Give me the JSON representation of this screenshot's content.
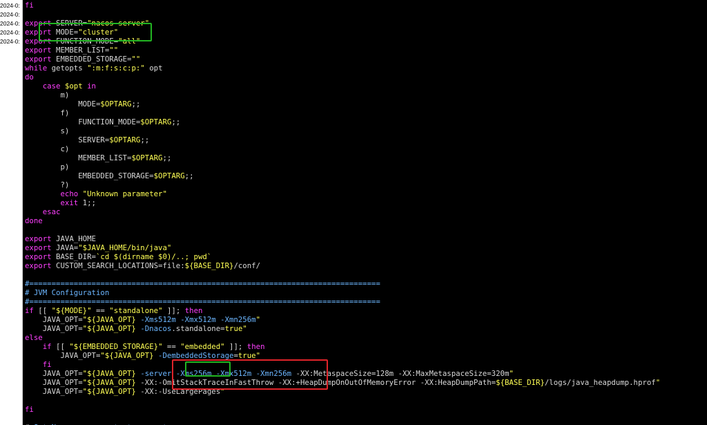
{
  "colors": {
    "background": "#000000",
    "default": "#d8d8d8",
    "keyword": "#ff40ff",
    "string": "#ffff55",
    "variable": "#ffff55",
    "comment": "#6cb6ff",
    "flag": "#6cb6ff",
    "highlight_green": "#22b522",
    "highlight_red": "#e0242a",
    "gutter_bg": "#ffffff"
  },
  "gutter": {
    "lines": [
      "2024-0:",
      "2024-0:",
      "2024-0:",
      "2024-0:",
      "2024-0:"
    ]
  },
  "code": {
    "lines": [
      [
        [
          "kw",
          "fi"
        ]
      ],
      [],
      [
        [
          "kw",
          "export"
        ],
        [
          "plain",
          " SERVER="
        ],
        [
          "str",
          "\"nacos-server\""
        ]
      ],
      [
        [
          "kw",
          "export"
        ],
        [
          "plain",
          " MODE="
        ],
        [
          "str",
          "\"cluster\""
        ]
      ],
      [
        [
          "kw",
          "export"
        ],
        [
          "plain",
          " FUNCTION_MODE="
        ],
        [
          "str",
          "\"all\""
        ]
      ],
      [
        [
          "kw",
          "export"
        ],
        [
          "plain",
          " MEMBER_LIST="
        ],
        [
          "str",
          "\"\""
        ]
      ],
      [
        [
          "kw",
          "export"
        ],
        [
          "plain",
          " EMBEDDED_STORAGE="
        ],
        [
          "str",
          "\"\""
        ]
      ],
      [
        [
          "kw",
          "while"
        ],
        [
          "plain",
          " getopts "
        ],
        [
          "str",
          "\":m:f:s:c:p:\""
        ],
        [
          "plain",
          " opt"
        ]
      ],
      [
        [
          "kw",
          "do"
        ]
      ],
      [
        [
          "plain",
          "    "
        ],
        [
          "kw",
          "case"
        ],
        [
          "plain",
          " "
        ],
        [
          "var",
          "$opt"
        ],
        [
          "plain",
          " "
        ],
        [
          "kw",
          "in"
        ]
      ],
      [
        [
          "plain",
          "        m)"
        ]
      ],
      [
        [
          "plain",
          "            MODE="
        ],
        [
          "var",
          "$OPTARG"
        ],
        [
          "plain",
          ";;"
        ]
      ],
      [
        [
          "plain",
          "        f)"
        ]
      ],
      [
        [
          "plain",
          "            FUNCTION_MODE="
        ],
        [
          "var",
          "$OPTARG"
        ],
        [
          "plain",
          ";;"
        ]
      ],
      [
        [
          "plain",
          "        s)"
        ]
      ],
      [
        [
          "plain",
          "            SERVER="
        ],
        [
          "var",
          "$OPTARG"
        ],
        [
          "plain",
          ";;"
        ]
      ],
      [
        [
          "plain",
          "        c)"
        ]
      ],
      [
        [
          "plain",
          "            MEMBER_LIST="
        ],
        [
          "var",
          "$OPTARG"
        ],
        [
          "plain",
          ";;"
        ]
      ],
      [
        [
          "plain",
          "        p)"
        ]
      ],
      [
        [
          "plain",
          "            EMBEDDED_STORAGE="
        ],
        [
          "var",
          "$OPTARG"
        ],
        [
          "plain",
          ";;"
        ]
      ],
      [
        [
          "plain",
          "        ?)"
        ]
      ],
      [
        [
          "plain",
          "        "
        ],
        [
          "kw",
          "echo"
        ],
        [
          "plain",
          " "
        ],
        [
          "str",
          "\"Unknown parameter\""
        ]
      ],
      [
        [
          "plain",
          "        "
        ],
        [
          "kw",
          "exit"
        ],
        [
          "plain",
          " 1;;"
        ]
      ],
      [
        [
          "plain",
          "    "
        ],
        [
          "kw",
          "esac"
        ]
      ],
      [
        [
          "kw",
          "done"
        ]
      ],
      [],
      [
        [
          "kw",
          "export"
        ],
        [
          "plain",
          " JAVA_HOME"
        ]
      ],
      [
        [
          "kw",
          "export"
        ],
        [
          "plain",
          " JAVA="
        ],
        [
          "str",
          "\"$JAVA_HOME/bin/java\""
        ]
      ],
      [
        [
          "kw",
          "export"
        ],
        [
          "plain",
          " BASE_DIR="
        ],
        [
          "str",
          "`cd $(dirname $0)/..; pwd`"
        ]
      ],
      [
        [
          "kw",
          "export"
        ],
        [
          "plain",
          " CUSTOM_SEARCH_LOCATIONS=file:"
        ],
        [
          "var",
          "${BASE_DIR}"
        ],
        [
          "plain",
          "/conf/"
        ]
      ],
      [],
      [
        [
          "cmt",
          "#==============================================================================="
        ]
      ],
      [
        [
          "cmt",
          "# JVM Configuration"
        ]
      ],
      [
        [
          "cmt",
          "#==============================================================================="
        ]
      ],
      [
        [
          "kw",
          "if"
        ],
        [
          "plain",
          " [[ "
        ],
        [
          "str",
          "\"${MODE}\""
        ],
        [
          "plain",
          " == "
        ],
        [
          "str",
          "\"standalone\""
        ],
        [
          "plain",
          " ]]; "
        ],
        [
          "kw",
          "then"
        ]
      ],
      [
        [
          "plain",
          "    JAVA_OPT="
        ],
        [
          "str",
          "\"${JAVA_OPT}"
        ],
        [
          "plain",
          " "
        ],
        [
          "flag",
          "-Xms512m -Xmx512m -Xmn256m"
        ],
        [
          "str",
          "\""
        ]
      ],
      [
        [
          "plain",
          "    JAVA_OPT="
        ],
        [
          "str",
          "\"${JAVA_OPT}"
        ],
        [
          "plain",
          " "
        ],
        [
          "flag",
          "-Dnacos"
        ],
        [
          "plain",
          ".standalone="
        ],
        [
          "str",
          "true\""
        ]
      ],
      [
        [
          "kw",
          "else"
        ]
      ],
      [
        [
          "plain",
          "    "
        ],
        [
          "kw",
          "if"
        ],
        [
          "plain",
          " [[ "
        ],
        [
          "str",
          "\"${EMBEDDED_STORAGE}\""
        ],
        [
          "plain",
          " == "
        ],
        [
          "str",
          "\"embedded\""
        ],
        [
          "plain",
          " ]]; "
        ],
        [
          "kw",
          "then"
        ]
      ],
      [
        [
          "plain",
          "        JAVA_OPT="
        ],
        [
          "str",
          "\"${JAVA_OPT}"
        ],
        [
          "plain",
          " "
        ],
        [
          "flag",
          "-DembeddedStorage"
        ],
        [
          "plain",
          "="
        ],
        [
          "str",
          "true\""
        ]
      ],
      [
        [
          "plain",
          "    "
        ],
        [
          "kw",
          "fi"
        ]
      ],
      [
        [
          "plain",
          "    JAVA_OPT="
        ],
        [
          "str",
          "\"${JAVA_OPT}"
        ],
        [
          "plain",
          " "
        ],
        [
          "flag",
          "-server -Xms256m -Xmx512m -Xmn256m"
        ],
        [
          "plain",
          " -XX:MetaspaceSize=128m -XX:MaxMetaspaceSize=320m"
        ],
        [
          "str",
          "\""
        ]
      ],
      [
        [
          "plain",
          "    JAVA_OPT="
        ],
        [
          "str",
          "\"${JAVA_OPT}"
        ],
        [
          "plain",
          " -XX:-OmitStackTraceInFastThrow -XX:+HeapDumpOnOutOfMemoryError -XX:HeapDumpPath="
        ],
        [
          "var",
          "${BASE_DIR}"
        ],
        [
          "plain",
          "/logs/java_heapdump.hprof"
        ],
        [
          "str",
          "\""
        ]
      ],
      [
        [
          "plain",
          "    JAVA_OPT="
        ],
        [
          "str",
          "\"${JAVA_OPT}"
        ],
        [
          "plain",
          " -XX:-UseLargePages"
        ],
        [
          "str",
          "\""
        ]
      ],
      [],
      [
        [
          "kw",
          "fi"
        ]
      ],
      [],
      [
        [
          "plain",
          "# "
        ],
        [
          "cmt",
          "Set Nacos server start parameters"
        ]
      ]
    ]
  },
  "highlights": [
    {
      "color": "green",
      "target_line": 3,
      "label": "cluster-mode-highlight"
    },
    {
      "color": "red",
      "target_line": 42,
      "label": "jvm-heap-options-highlight"
    },
    {
      "color": "green",
      "target_line": 42,
      "label": "xms256m-highlight"
    }
  ]
}
